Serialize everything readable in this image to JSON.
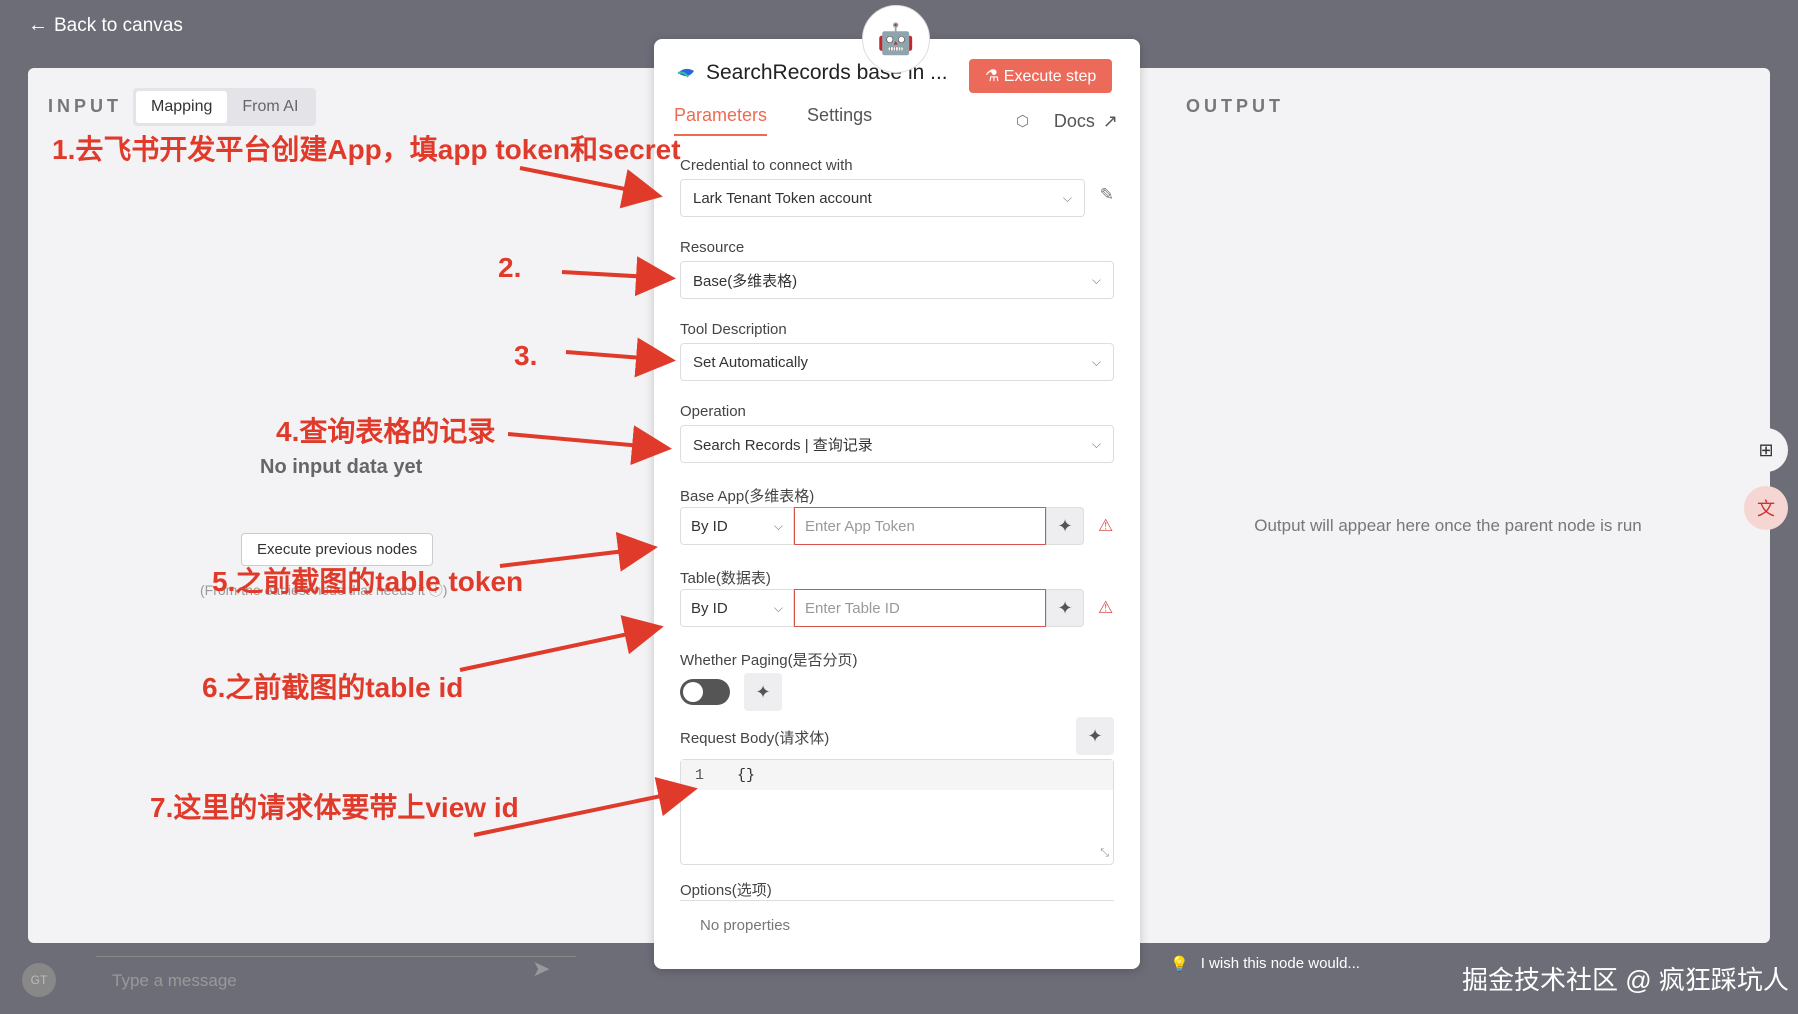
{
  "topbar": {
    "back_label": "Back to canvas"
  },
  "input": {
    "label": "INPUT",
    "tab_mapping": "Mapping",
    "tab_from_ai": "From AI",
    "no_data": "No input data yet",
    "exec_prev": "Execute previous nodes",
    "from_earliest": "(From the earliest node that needs it ⓘ)"
  },
  "output": {
    "label": "OUTPUT",
    "message": "Output will appear here once the parent node is run",
    "wish": "I wish this node would..."
  },
  "node": {
    "title": "SearchRecords base in ...",
    "execute_step": "Execute step",
    "tab_parameters": "Parameters",
    "tab_settings": "Settings",
    "docs": "Docs",
    "credential_label": "Credential to connect with",
    "credential_value": "Lark Tenant Token account",
    "resource_label": "Resource",
    "resource_value": "Base(多维表格)",
    "tool_desc_label": "Tool Description",
    "tool_desc_value": "Set Automatically",
    "operation_label": "Operation",
    "operation_value": "Search Records | 查询记录",
    "base_app_label": "Base App(多维表格)",
    "base_app_mode": "By ID",
    "base_app_placeholder": "Enter App Token",
    "table_label": "Table(数据表)",
    "table_mode": "By ID",
    "table_placeholder": "Enter Table ID",
    "paging_label": "Whether Paging(是否分页)",
    "paging_enabled": false,
    "request_body_label": "Request Body(请求体)",
    "request_body_line_no": "1",
    "request_body_code": "{}",
    "options_label": "Options(选项)",
    "no_properties": "No properties"
  },
  "annotations": {
    "a1": "1.去飞书开发平台创建App，填app token和secret",
    "a2": "2.",
    "a3": "3.",
    "a4": "4.查询表格的记录",
    "a5": "5.之前截图的table token",
    "a6": "6.之前截图的table id",
    "a7": "7.这里的请求体要带上view id"
  },
  "chat": {
    "avatar": "GT",
    "placeholder": "Type a message"
  },
  "watermark": "掘金技术社区 @ 疯狂踩坑人",
  "colors": {
    "accent": "#ef6a51",
    "annotation": "#e03a2a",
    "error": "#d9534f"
  }
}
